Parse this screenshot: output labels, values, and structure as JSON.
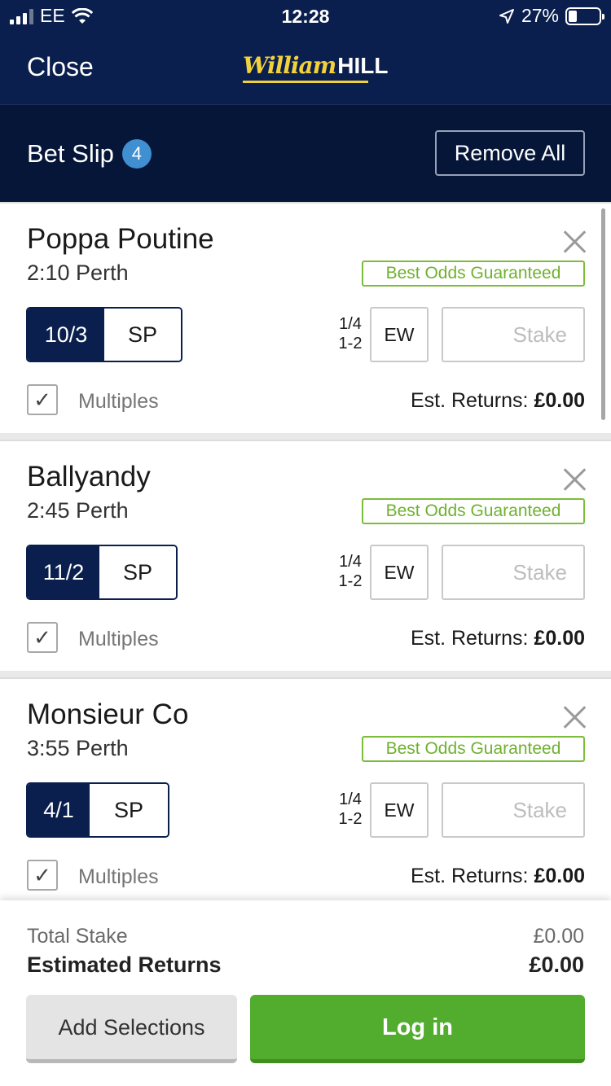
{
  "status_bar": {
    "carrier": "EE",
    "time": "12:28",
    "battery": "27%",
    "battery_level": 0.27,
    "icons": [
      "signal-icon",
      "wifi-icon",
      "location-icon",
      "battery-icon"
    ]
  },
  "header": {
    "close_label": "Close",
    "logo_script": "William",
    "logo_bold": "HILL"
  },
  "slip": {
    "title": "Bet Slip",
    "count": "4",
    "remove_all_label": "Remove All"
  },
  "selections": [
    {
      "horse": "Poppa Poutine",
      "race": "2:10 Perth",
      "badge": "Best Odds Guaranteed",
      "price": "10/3",
      "sp": "SP",
      "terms_top": "1/4",
      "terms_bottom": "1-2",
      "ew": "EW",
      "stake_placeholder": "Stake",
      "multiples_label": "Multiples",
      "multiples_checked": true,
      "est_label": "Est. Returns:",
      "est_value": "£0.00"
    },
    {
      "horse": "Ballyandy",
      "race": "2:45 Perth",
      "badge": "Best Odds Guaranteed",
      "price": "11/2",
      "sp": "SP",
      "terms_top": "1/4",
      "terms_bottom": "1-2",
      "ew": "EW",
      "stake_placeholder": "Stake",
      "multiples_label": "Multiples",
      "multiples_checked": true,
      "est_label": "Est. Returns:",
      "est_value": "£0.00"
    },
    {
      "horse": "Monsieur Co",
      "race": "3:55 Perth",
      "badge": "Best Odds Guaranteed",
      "price": "4/1",
      "sp": "SP",
      "terms_top": "1/4",
      "terms_bottom": "1-2",
      "ew": "EW",
      "stake_placeholder": "Stake",
      "multiples_label": "Multiples",
      "multiples_checked": true,
      "est_label": "Est. Returns:",
      "est_value": "£0.00"
    }
  ],
  "footer": {
    "total_stake_label": "Total Stake",
    "total_stake_value": "£0.00",
    "estimated_returns_label": "Estimated Returns",
    "estimated_returns_value": "£0.00",
    "add_selections_label": "Add Selections",
    "login_label": "Log in"
  },
  "colors": {
    "header_bg": "#0b1f4e",
    "slipbar_bg": "#061638",
    "badge_green": "#7cbd3c",
    "login_green": "#52ad2e",
    "count_blue": "#3f8fd1",
    "logo_yellow": "#f2d13b"
  }
}
